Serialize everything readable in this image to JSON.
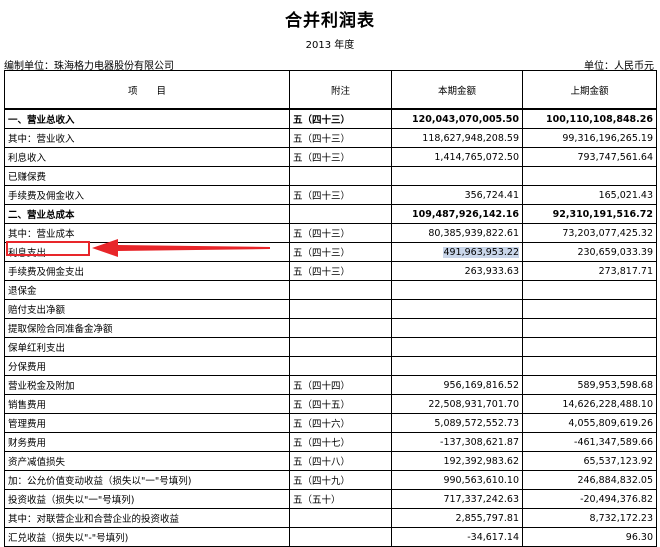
{
  "document": {
    "title": "合并利润表",
    "period": "2013 年度",
    "company_label": "编制单位：珠海格力电器股份有限公司",
    "unit_label": "单位：人民币元"
  },
  "table": {
    "headers": [
      "项　　目",
      "附注",
      "本期金额",
      "上期金额"
    ],
    "rows": [
      {
        "label": "一、营业总收入",
        "note": "五（四十三）",
        "current": "120,043,070,005.50",
        "previous": "100,110,108,848.26",
        "bold": true
      },
      {
        "label": "其中：营业收入",
        "note": "五（四十三）",
        "current": "118,627,948,208.59",
        "previous": "99,316,196,265.19"
      },
      {
        "label": "利息收入",
        "note": "五（四十三）",
        "current": "1,414,765,072.50",
        "previous": "793,747,561.64"
      },
      {
        "label": "已赚保费",
        "note": "",
        "current": "",
        "previous": ""
      },
      {
        "label": "手续费及佣金收入",
        "note": "五（四十三）",
        "current": "356,724.41",
        "previous": "165,021.43"
      },
      {
        "label": "二、营业总成本",
        "note": "",
        "current": "109,487,926,142.16",
        "previous": "92,310,191,516.72",
        "bold": true
      },
      {
        "label": "其中：营业成本",
        "note": "五（四十三）",
        "current": "80,385,939,822.61",
        "previous": "73,203,077,425.32"
      },
      {
        "label": "利息支出",
        "note": "五（四十三）",
        "current": "491,963,953.22",
        "previous": "230,659,033.39",
        "highlight": true
      },
      {
        "label": "手续费及佣金支出",
        "note": "五（四十三）",
        "current": "263,933.63",
        "previous": "273,817.71"
      },
      {
        "label": "退保金",
        "note": "",
        "current": "",
        "previous": ""
      },
      {
        "label": "赔付支出净额",
        "note": "",
        "current": "",
        "previous": ""
      },
      {
        "label": "提取保险合同准备金净额",
        "note": "",
        "current": "",
        "previous": ""
      },
      {
        "label": "保单红利支出",
        "note": "",
        "current": "",
        "previous": ""
      },
      {
        "label": "分保费用",
        "note": "",
        "current": "",
        "previous": ""
      },
      {
        "label": "营业税金及附加",
        "note": "五（四十四）",
        "current": "956,169,816.52",
        "previous": "589,953,598.68"
      },
      {
        "label": "销售费用",
        "note": "五（四十五）",
        "current": "22,508,931,701.70",
        "previous": "14,626,228,488.10"
      },
      {
        "label": "管理费用",
        "note": "五（四十六）",
        "current": "5,089,572,552.73",
        "previous": "4,055,809,619.26"
      },
      {
        "label": "财务费用",
        "note": "五（四十七）",
        "current": "-137,308,621.87",
        "previous": "-461,347,589.66"
      },
      {
        "label": "资产减值损失",
        "note": "五（四十八）",
        "current": "192,392,983.62",
        "previous": "65,537,123.92"
      },
      {
        "label": "加：公允价值变动收益（损失以\"一\"号填列)",
        "note": "五（四十九）",
        "current": "990,563,610.10",
        "previous": "246,884,832.05"
      },
      {
        "label": "投资收益（损失以\"一\"号填列)",
        "note": "五（五十）",
        "current": "717,337,242.63",
        "previous": "-20,494,376.82"
      },
      {
        "label": "其中：对联营企业和合营企业的投资收益",
        "note": "",
        "current": "2,855,797.81",
        "previous": "8,732,172.23"
      },
      {
        "label": "汇兑收益（损失以\"-\"号填列)",
        "note": "",
        "current": "-34,617.14",
        "previous": "96.30"
      }
    ]
  },
  "annotation": {
    "box_color": "#e8262a",
    "arrow_color": "#e8262a",
    "highlight_color": "#c9d6ea"
  }
}
